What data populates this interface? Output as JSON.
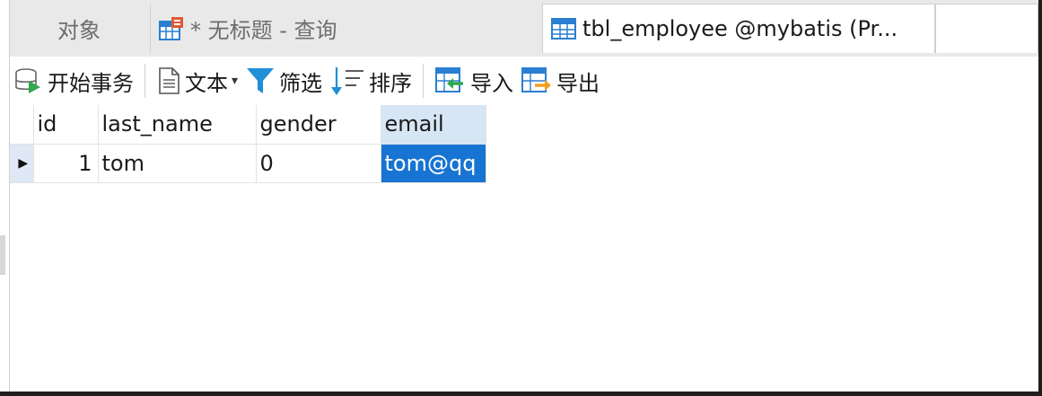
{
  "tabs": [
    {
      "label": "对象",
      "icon": "none"
    },
    {
      "label": "* 无标题 - 查询",
      "icon": "query-table-icon"
    },
    {
      "label": "tbl_employee @mybatis (Pr...",
      "icon": "table-grid-icon"
    }
  ],
  "toolbar": {
    "begin_transaction": "开始事务",
    "text": "文本",
    "filter": "筛选",
    "sort": "排序",
    "import": "导入",
    "export": "导出"
  },
  "grid": {
    "columns": [
      "id",
      "last_name",
      "gender",
      "email"
    ],
    "rows": [
      {
        "id": "1",
        "last_name": "tom",
        "gender": "0",
        "email": "tom@qq"
      }
    ],
    "row_marker": "▶"
  },
  "colors": {
    "selected_cell": "#1874d2",
    "selected_header": "#d7e6f5",
    "filter_icon": "#1f8fd6"
  }
}
